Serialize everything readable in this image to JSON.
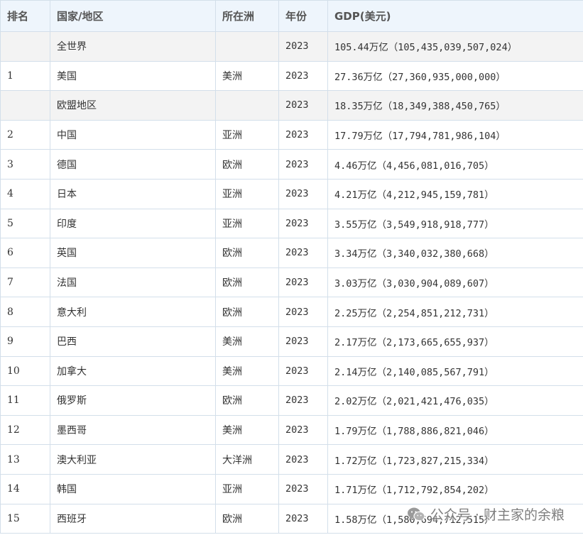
{
  "table": {
    "headers": [
      "排名",
      "国家/地区",
      "所在洲",
      "年份",
      "GDP(美元)"
    ],
    "rows": [
      {
        "rank": "",
        "country": "全世界",
        "continent": "",
        "year": "2023",
        "gdp": "105.44万亿（105,435,039,507,024）",
        "aggregate": true
      },
      {
        "rank": "1",
        "country": "美国",
        "continent": "美洲",
        "year": "2023",
        "gdp": "27.36万亿（27,360,935,000,000）",
        "aggregate": false
      },
      {
        "rank": "",
        "country": "欧盟地区",
        "continent": "",
        "year": "2023",
        "gdp": "18.35万亿（18,349,388,450,765）",
        "aggregate": true
      },
      {
        "rank": "2",
        "country": "中国",
        "continent": "亚洲",
        "year": "2023",
        "gdp": "17.79万亿（17,794,781,986,104）",
        "aggregate": false
      },
      {
        "rank": "3",
        "country": "德国",
        "continent": "欧洲",
        "year": "2023",
        "gdp": "4.46万亿（4,456,081,016,705）",
        "aggregate": false
      },
      {
        "rank": "4",
        "country": "日本",
        "continent": "亚洲",
        "year": "2023",
        "gdp": "4.21万亿（4,212,945,159,781）",
        "aggregate": false
      },
      {
        "rank": "5",
        "country": "印度",
        "continent": "亚洲",
        "year": "2023",
        "gdp": "3.55万亿（3,549,918,918,777）",
        "aggregate": false
      },
      {
        "rank": "6",
        "country": "英国",
        "continent": "欧洲",
        "year": "2023",
        "gdp": "3.34万亿（3,340,032,380,668）",
        "aggregate": false
      },
      {
        "rank": "7",
        "country": "法国",
        "continent": "欧洲",
        "year": "2023",
        "gdp": "3.03万亿（3,030,904,089,607）",
        "aggregate": false
      },
      {
        "rank": "8",
        "country": "意大利",
        "continent": "欧洲",
        "year": "2023",
        "gdp": "2.25万亿（2,254,851,212,731）",
        "aggregate": false
      },
      {
        "rank": "9",
        "country": "巴西",
        "continent": "美洲",
        "year": "2023",
        "gdp": "2.17万亿（2,173,665,655,937）",
        "aggregate": false
      },
      {
        "rank": "10",
        "country": "加拿大",
        "continent": "美洲",
        "year": "2023",
        "gdp": "2.14万亿（2,140,085,567,791）",
        "aggregate": false
      },
      {
        "rank": "11",
        "country": "俄罗斯",
        "continent": "欧洲",
        "year": "2023",
        "gdp": "2.02万亿（2,021,421,476,035）",
        "aggregate": false
      },
      {
        "rank": "12",
        "country": "墨西哥",
        "continent": "美洲",
        "year": "2023",
        "gdp": "1.79万亿（1,788,886,821,046）",
        "aggregate": false
      },
      {
        "rank": "13",
        "country": "澳大利亚",
        "continent": "大洋洲",
        "year": "2023",
        "gdp": "1.72万亿（1,723,827,215,334）",
        "aggregate": false
      },
      {
        "rank": "14",
        "country": "韩国",
        "continent": "亚洲",
        "year": "2023",
        "gdp": "1.71万亿（1,712,792,854,202）",
        "aggregate": false
      },
      {
        "rank": "15",
        "country": "西班牙",
        "continent": "欧洲",
        "year": "2023",
        "gdp": "1.58万亿（1,580,694,712,515）",
        "aggregate": false
      }
    ]
  },
  "watermark": {
    "text": "公众号 · 财主家的余粮",
    "icon": "wechat-icon"
  },
  "colors": {
    "header_bg": "#eef5fc",
    "aggregate_row_bg": "#f3f3f3",
    "border": "#d3dfea"
  }
}
